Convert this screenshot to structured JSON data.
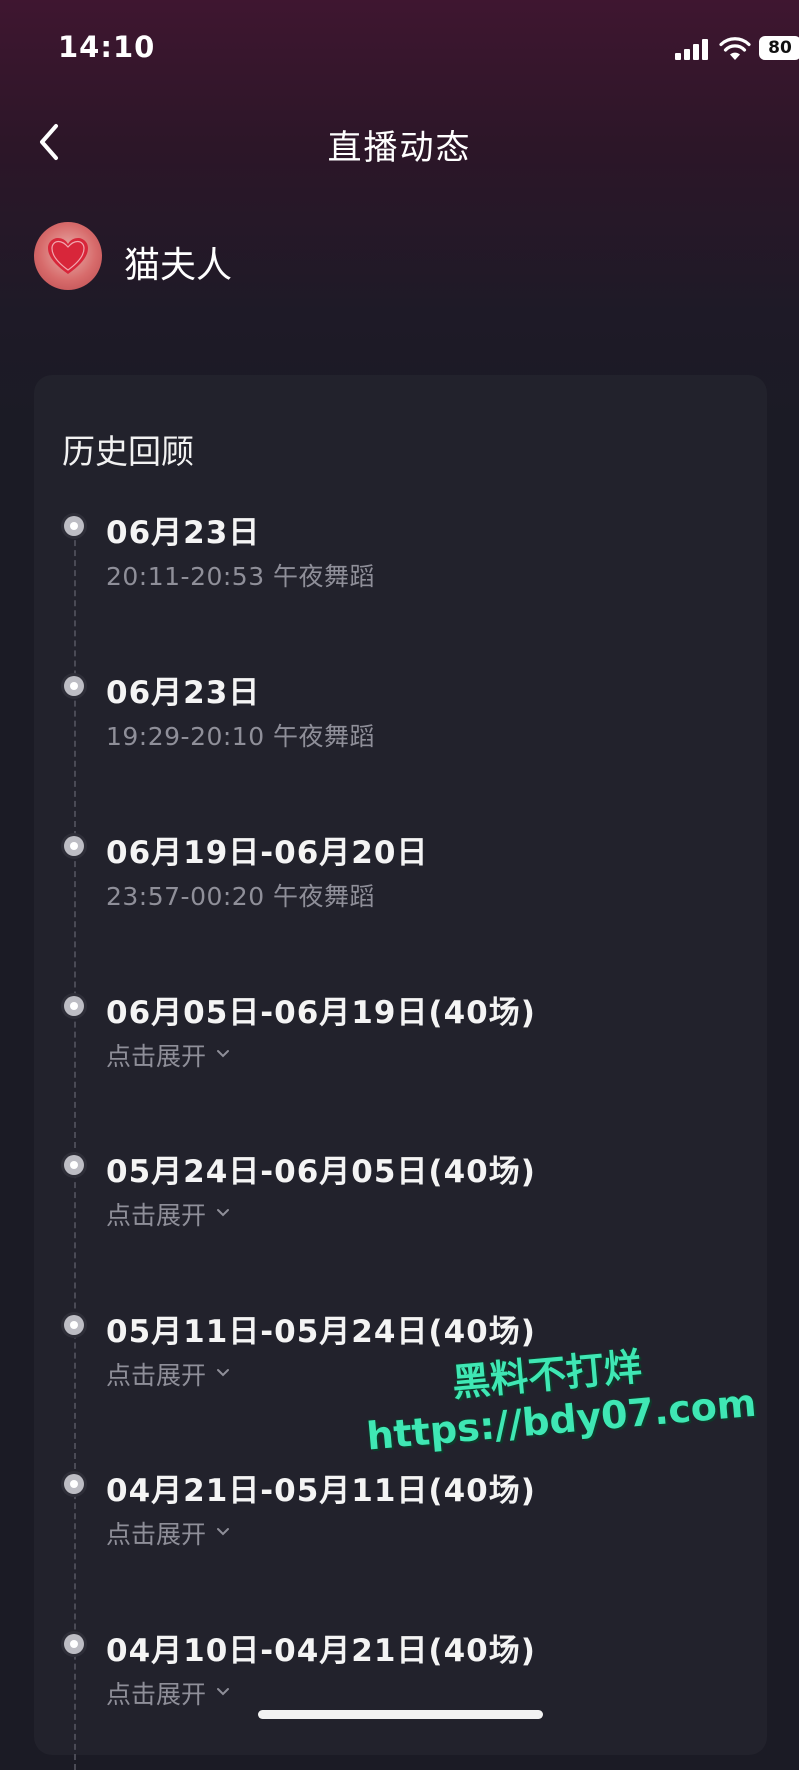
{
  "status_bar": {
    "time": "14:10",
    "battery": "80",
    "icons": [
      "signal-icon",
      "wifi-icon",
      "battery-icon"
    ]
  },
  "header": {
    "title": "直播动态",
    "back_icon": "back-chevron-icon"
  },
  "profile": {
    "name": "猫夫人"
  },
  "history": {
    "title": "历史回顾",
    "expand_label": "点击展开",
    "entries": [
      {
        "date": "06月23日",
        "detail": "20:11-20:53 午夜舞蹈"
      },
      {
        "date": "06月23日",
        "detail": "19:29-20:10 午夜舞蹈"
      },
      {
        "date": "06月19日-06月20日",
        "detail": "23:57-00:20 午夜舞蹈"
      },
      {
        "date": "06月05日-06月19日(40场)"
      },
      {
        "date": "05月24日-06月05日(40场)"
      },
      {
        "date": "05月11日-05月24日(40场)"
      },
      {
        "date": "04月21日-05月11日(40场)"
      },
      {
        "date": "04月10日-04月21日(40场)"
      }
    ]
  },
  "watermark": {
    "line1": "黑料不打烊",
    "line2": "https://bdy07.com"
  },
  "colors": {
    "background": "#1b1b25",
    "card": "#22222c",
    "header_gradient_top": "#3f1630",
    "secondary_text": "#8f8f99",
    "watermark": "#3fe7b4"
  }
}
